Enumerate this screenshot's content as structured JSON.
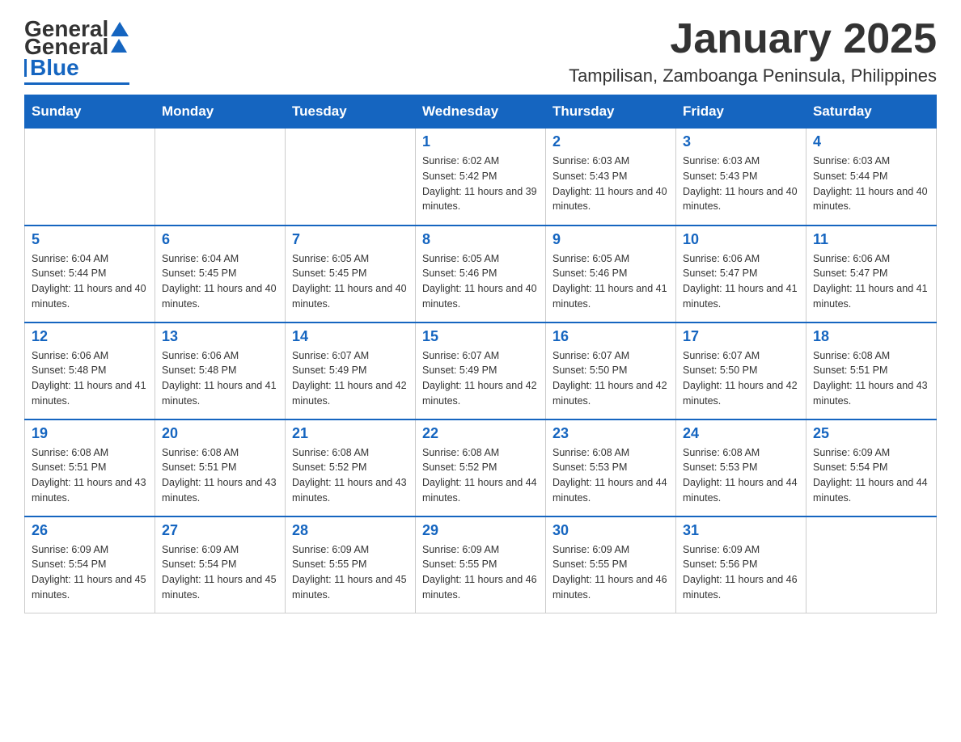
{
  "logo": {
    "general": "General",
    "blue": "Blue"
  },
  "title": "January 2025",
  "subtitle": "Tampilisan, Zamboanga Peninsula, Philippines",
  "weekdays": [
    "Sunday",
    "Monday",
    "Tuesday",
    "Wednesday",
    "Thursday",
    "Friday",
    "Saturday"
  ],
  "weeks": [
    [
      {
        "day": "",
        "sunrise": "",
        "sunset": "",
        "daylight": ""
      },
      {
        "day": "",
        "sunrise": "",
        "sunset": "",
        "daylight": ""
      },
      {
        "day": "",
        "sunrise": "",
        "sunset": "",
        "daylight": ""
      },
      {
        "day": "1",
        "sunrise": "Sunrise: 6:02 AM",
        "sunset": "Sunset: 5:42 PM",
        "daylight": "Daylight: 11 hours and 39 minutes."
      },
      {
        "day": "2",
        "sunrise": "Sunrise: 6:03 AM",
        "sunset": "Sunset: 5:43 PM",
        "daylight": "Daylight: 11 hours and 40 minutes."
      },
      {
        "day": "3",
        "sunrise": "Sunrise: 6:03 AM",
        "sunset": "Sunset: 5:43 PM",
        "daylight": "Daylight: 11 hours and 40 minutes."
      },
      {
        "day": "4",
        "sunrise": "Sunrise: 6:03 AM",
        "sunset": "Sunset: 5:44 PM",
        "daylight": "Daylight: 11 hours and 40 minutes."
      }
    ],
    [
      {
        "day": "5",
        "sunrise": "Sunrise: 6:04 AM",
        "sunset": "Sunset: 5:44 PM",
        "daylight": "Daylight: 11 hours and 40 minutes."
      },
      {
        "day": "6",
        "sunrise": "Sunrise: 6:04 AM",
        "sunset": "Sunset: 5:45 PM",
        "daylight": "Daylight: 11 hours and 40 minutes."
      },
      {
        "day": "7",
        "sunrise": "Sunrise: 6:05 AM",
        "sunset": "Sunset: 5:45 PM",
        "daylight": "Daylight: 11 hours and 40 minutes."
      },
      {
        "day": "8",
        "sunrise": "Sunrise: 6:05 AM",
        "sunset": "Sunset: 5:46 PM",
        "daylight": "Daylight: 11 hours and 40 minutes."
      },
      {
        "day": "9",
        "sunrise": "Sunrise: 6:05 AM",
        "sunset": "Sunset: 5:46 PM",
        "daylight": "Daylight: 11 hours and 41 minutes."
      },
      {
        "day": "10",
        "sunrise": "Sunrise: 6:06 AM",
        "sunset": "Sunset: 5:47 PM",
        "daylight": "Daylight: 11 hours and 41 minutes."
      },
      {
        "day": "11",
        "sunrise": "Sunrise: 6:06 AM",
        "sunset": "Sunset: 5:47 PM",
        "daylight": "Daylight: 11 hours and 41 minutes."
      }
    ],
    [
      {
        "day": "12",
        "sunrise": "Sunrise: 6:06 AM",
        "sunset": "Sunset: 5:48 PM",
        "daylight": "Daylight: 11 hours and 41 minutes."
      },
      {
        "day": "13",
        "sunrise": "Sunrise: 6:06 AM",
        "sunset": "Sunset: 5:48 PM",
        "daylight": "Daylight: 11 hours and 41 minutes."
      },
      {
        "day": "14",
        "sunrise": "Sunrise: 6:07 AM",
        "sunset": "Sunset: 5:49 PM",
        "daylight": "Daylight: 11 hours and 42 minutes."
      },
      {
        "day": "15",
        "sunrise": "Sunrise: 6:07 AM",
        "sunset": "Sunset: 5:49 PM",
        "daylight": "Daylight: 11 hours and 42 minutes."
      },
      {
        "day": "16",
        "sunrise": "Sunrise: 6:07 AM",
        "sunset": "Sunset: 5:50 PM",
        "daylight": "Daylight: 11 hours and 42 minutes."
      },
      {
        "day": "17",
        "sunrise": "Sunrise: 6:07 AM",
        "sunset": "Sunset: 5:50 PM",
        "daylight": "Daylight: 11 hours and 42 minutes."
      },
      {
        "day": "18",
        "sunrise": "Sunrise: 6:08 AM",
        "sunset": "Sunset: 5:51 PM",
        "daylight": "Daylight: 11 hours and 43 minutes."
      }
    ],
    [
      {
        "day": "19",
        "sunrise": "Sunrise: 6:08 AM",
        "sunset": "Sunset: 5:51 PM",
        "daylight": "Daylight: 11 hours and 43 minutes."
      },
      {
        "day": "20",
        "sunrise": "Sunrise: 6:08 AM",
        "sunset": "Sunset: 5:51 PM",
        "daylight": "Daylight: 11 hours and 43 minutes."
      },
      {
        "day": "21",
        "sunrise": "Sunrise: 6:08 AM",
        "sunset": "Sunset: 5:52 PM",
        "daylight": "Daylight: 11 hours and 43 minutes."
      },
      {
        "day": "22",
        "sunrise": "Sunrise: 6:08 AM",
        "sunset": "Sunset: 5:52 PM",
        "daylight": "Daylight: 11 hours and 44 minutes."
      },
      {
        "day": "23",
        "sunrise": "Sunrise: 6:08 AM",
        "sunset": "Sunset: 5:53 PM",
        "daylight": "Daylight: 11 hours and 44 minutes."
      },
      {
        "day": "24",
        "sunrise": "Sunrise: 6:08 AM",
        "sunset": "Sunset: 5:53 PM",
        "daylight": "Daylight: 11 hours and 44 minutes."
      },
      {
        "day": "25",
        "sunrise": "Sunrise: 6:09 AM",
        "sunset": "Sunset: 5:54 PM",
        "daylight": "Daylight: 11 hours and 44 minutes."
      }
    ],
    [
      {
        "day": "26",
        "sunrise": "Sunrise: 6:09 AM",
        "sunset": "Sunset: 5:54 PM",
        "daylight": "Daylight: 11 hours and 45 minutes."
      },
      {
        "day": "27",
        "sunrise": "Sunrise: 6:09 AM",
        "sunset": "Sunset: 5:54 PM",
        "daylight": "Daylight: 11 hours and 45 minutes."
      },
      {
        "day": "28",
        "sunrise": "Sunrise: 6:09 AM",
        "sunset": "Sunset: 5:55 PM",
        "daylight": "Daylight: 11 hours and 45 minutes."
      },
      {
        "day": "29",
        "sunrise": "Sunrise: 6:09 AM",
        "sunset": "Sunset: 5:55 PM",
        "daylight": "Daylight: 11 hours and 46 minutes."
      },
      {
        "day": "30",
        "sunrise": "Sunrise: 6:09 AM",
        "sunset": "Sunset: 5:55 PM",
        "daylight": "Daylight: 11 hours and 46 minutes."
      },
      {
        "day": "31",
        "sunrise": "Sunrise: 6:09 AM",
        "sunset": "Sunset: 5:56 PM",
        "daylight": "Daylight: 11 hours and 46 minutes."
      },
      {
        "day": "",
        "sunrise": "",
        "sunset": "",
        "daylight": ""
      }
    ]
  ]
}
